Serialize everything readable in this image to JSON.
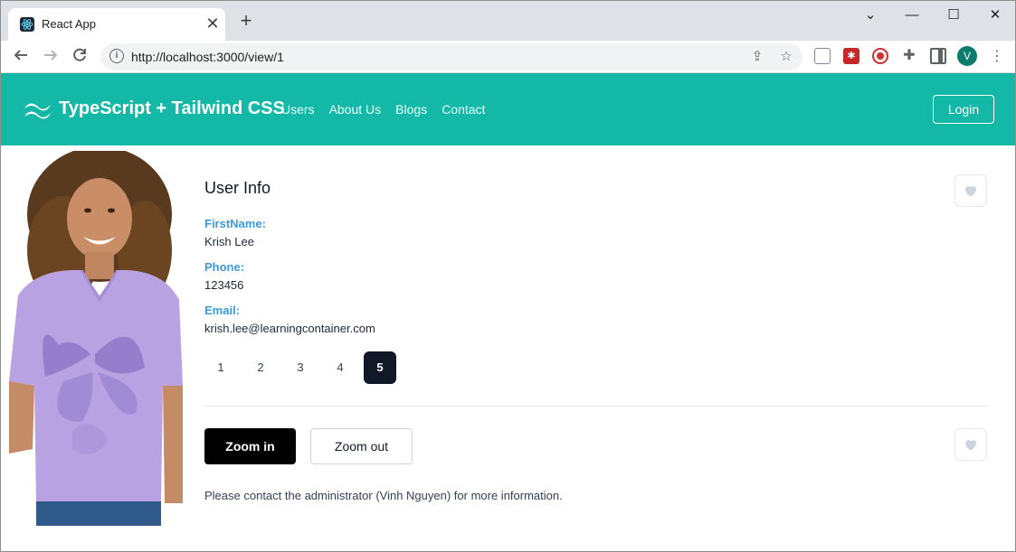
{
  "browser": {
    "tab_title": "React App",
    "tab_close": "✕",
    "new_tab": "+",
    "url": "http://localhost:3000/view/1",
    "profile_initial": "V",
    "window_controls": [
      "⌄",
      "—",
      "☐",
      "✕"
    ]
  },
  "nav": {
    "brand": "TypeScript + Tailwind CSS",
    "links": [
      "Users",
      "About Us",
      "Blogs",
      "Contact"
    ],
    "login": "Login"
  },
  "user": {
    "title": "User Info",
    "first_name_label": "FirstName:",
    "first_name": "Krish Lee",
    "phone_label": "Phone:",
    "phone": "123456",
    "email_label": "Email:",
    "email": "krish.lee@learningcontainer.com"
  },
  "pagination": {
    "pages": [
      "1",
      "2",
      "3",
      "4",
      "5"
    ],
    "active": "5"
  },
  "actions": {
    "zoom_in": "Zoom in",
    "zoom_out": "Zoom out"
  },
  "footnote": "Please contact the administrator (Vinh Nguyen) for more information.",
  "colors": {
    "navbar": "#14b8a6",
    "label": "#3b9bd8",
    "active_page": "#111827"
  }
}
